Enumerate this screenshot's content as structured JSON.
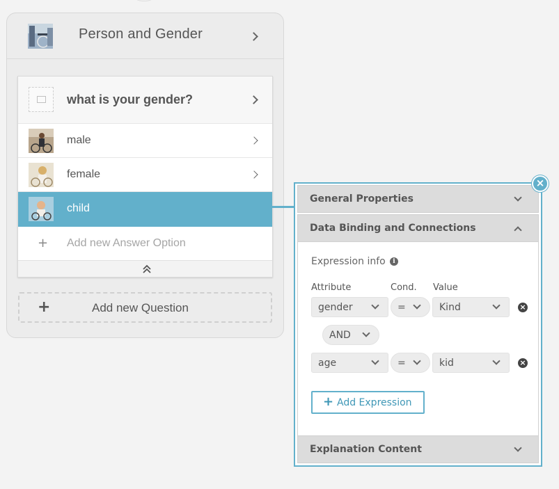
{
  "group": {
    "title": "Person and Gender"
  },
  "question": {
    "title": "what is your gender?"
  },
  "answers": [
    {
      "label": "male",
      "selected": false
    },
    {
      "label": "female",
      "selected": false
    },
    {
      "label": "child",
      "selected": true
    }
  ],
  "add_answer_label": "Add new Answer Option",
  "add_question_label": "Add new Question",
  "panel": {
    "sections": {
      "general": "General Properties",
      "binding": "Data Binding and Connections",
      "explanation": "Explanation Content"
    },
    "expression_info_label": "Expression info",
    "columns": {
      "attribute": "Attribute",
      "cond": "Cond.",
      "value": "Value"
    },
    "expressions": [
      {
        "attribute": "gender",
        "cond": "=",
        "value": "Kind"
      },
      {
        "attribute": "age",
        "cond": "=",
        "value": "kid"
      }
    ],
    "operator": "AND",
    "add_expression_label": "Add Expression"
  },
  "colors": {
    "accent": "#62b0cb",
    "accent_text": "#3f97b6",
    "background": "#f3f3f3"
  }
}
